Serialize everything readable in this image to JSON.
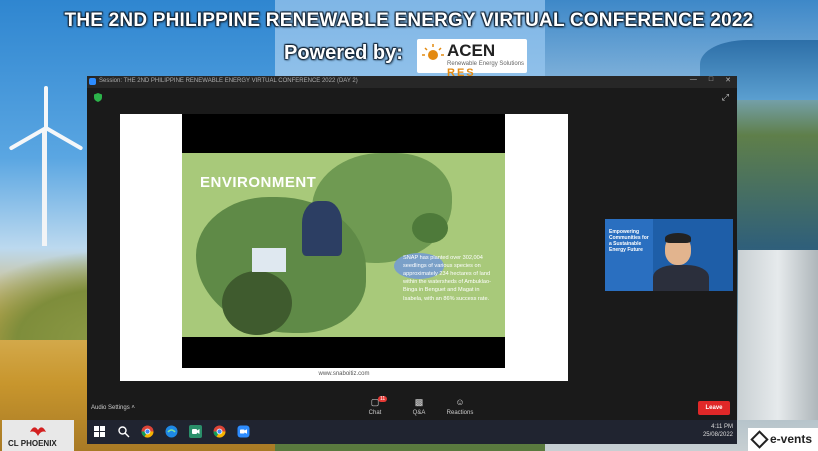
{
  "banner": {
    "title": "THE 2ND PHILIPPINE RENEWABLE ENERGY VIRTUAL CONFERENCE 2022",
    "powered_by": "Powered by:",
    "sponsor_name": "ACEN",
    "sponsor_suffix": "RES",
    "sponsor_tagline": "Renewable Energy Solutions"
  },
  "bottom_logos": {
    "left": "CL PHOENIX",
    "right": "e-vents"
  },
  "zoom": {
    "window_title": "Session: THE 2ND PHILIPPINE RENEWABLE ENERGY VIRTUAL CONFERENCE 2022 (DAY 2)",
    "slide": {
      "heading": "ENVIRONMENT",
      "body": "SNAP has planted over 302,004 seedlings of various species on approximately 234 hectares of land within the watersheds of Ambuklao-Binga in Benguet and Magat in Isabela, with an 86% success rate.",
      "url": "www.snaboitiz.com"
    },
    "video_tile": {
      "slide_title": "Empowering Communities for a Sustainable Energy Future"
    },
    "toolbar": {
      "audio_settings": "Audio Settings",
      "chat": "Chat",
      "chat_badge": "11",
      "qa": "Q&A",
      "reactions": "Reactions",
      "leave": "Leave"
    }
  },
  "taskbar": {
    "time": "4:11 PM",
    "date": "25/08/2022"
  }
}
